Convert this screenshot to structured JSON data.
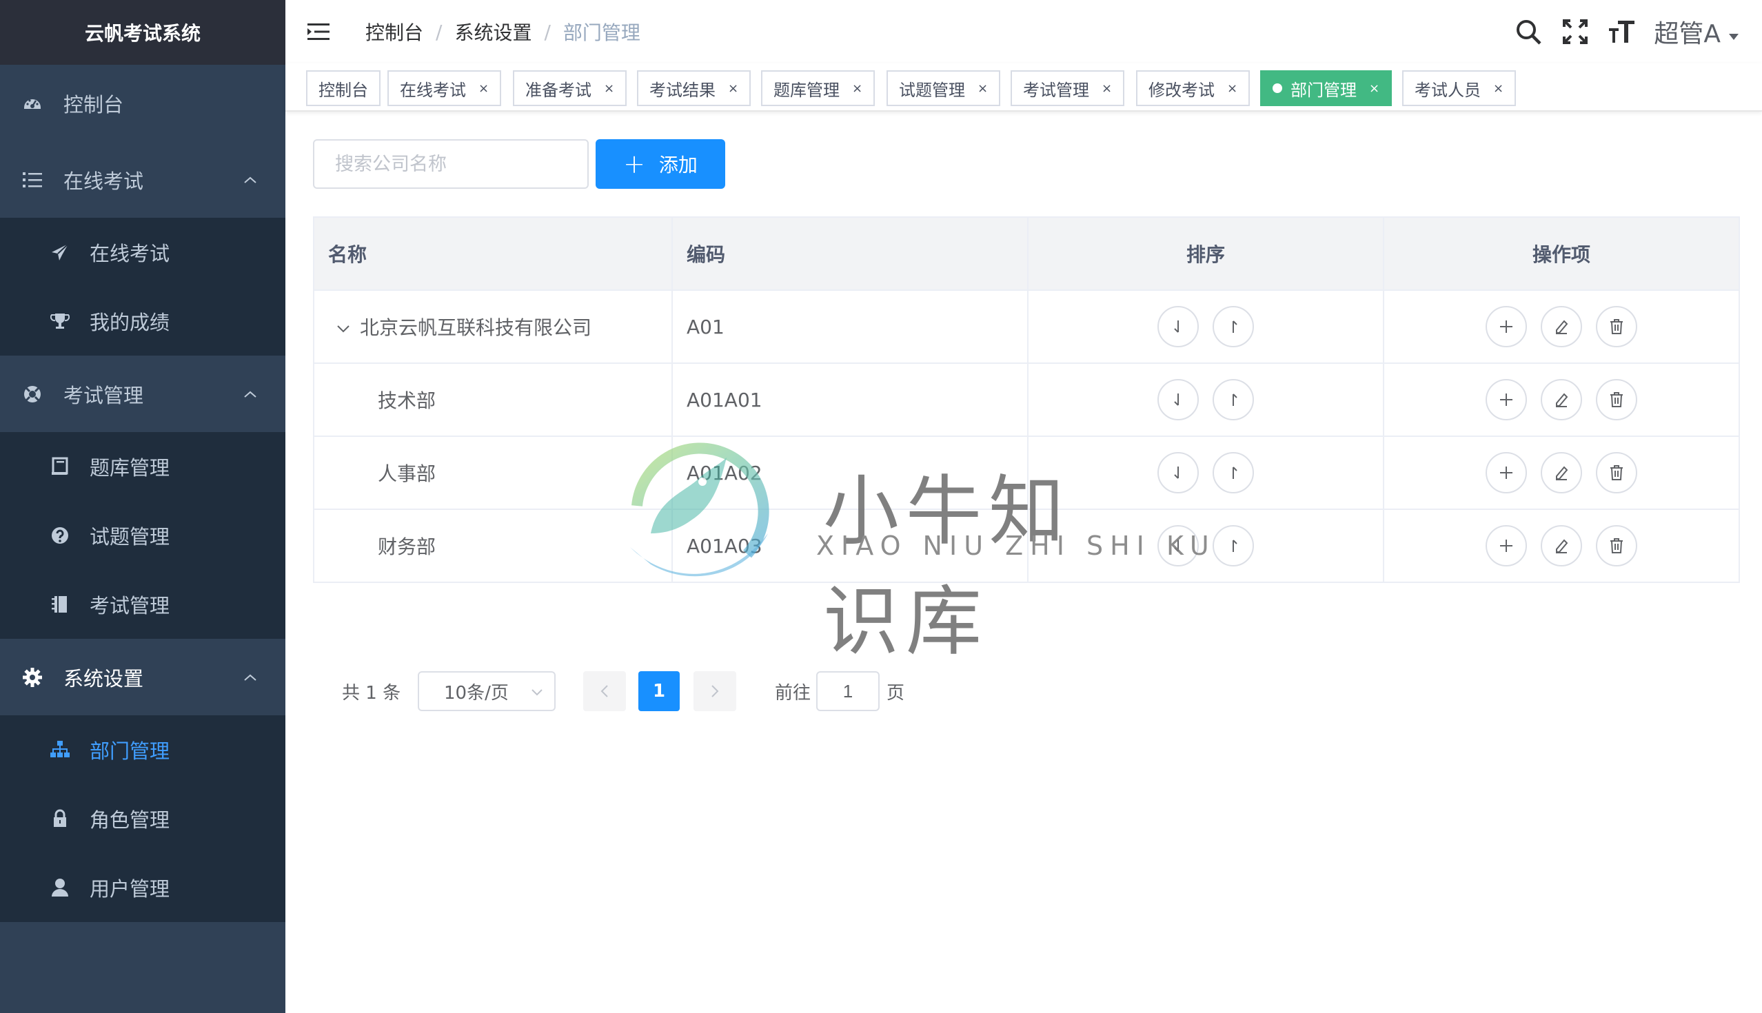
{
  "app": {
    "title": "云帆考试系统"
  },
  "sidebar": {
    "items": [
      {
        "label": "控制台",
        "icon": "dashboard-icon"
      },
      {
        "label": "在线考试",
        "icon": "list-icon",
        "children": [
          {
            "label": "在线考试",
            "icon": "paper-plane-icon"
          },
          {
            "label": "我的成绩",
            "icon": "trophy-icon"
          }
        ]
      },
      {
        "label": "考试管理",
        "icon": "lifebuoy-icon",
        "children": [
          {
            "label": "题库管理",
            "icon": "book-icon"
          },
          {
            "label": "试题管理",
            "icon": "question-icon"
          },
          {
            "label": "考试管理",
            "icon": "notebook-icon"
          }
        ]
      },
      {
        "label": "系统设置",
        "icon": "gear-icon",
        "children": [
          {
            "label": "部门管理",
            "icon": "sitemap-icon",
            "active": true
          },
          {
            "label": "角色管理",
            "icon": "lock-icon"
          },
          {
            "label": "用户管理",
            "icon": "user-icon"
          }
        ]
      }
    ]
  },
  "navbar": {
    "breadcrumb": [
      "控制台",
      "系统设置",
      "部门管理"
    ],
    "user_name": "超管A"
  },
  "tags": [
    {
      "label": "控制台",
      "closable": false
    },
    {
      "label": "在线考试",
      "closable": true
    },
    {
      "label": "准备考试",
      "closable": true
    },
    {
      "label": "考试结果",
      "closable": true
    },
    {
      "label": "题库管理",
      "closable": true
    },
    {
      "label": "试题管理",
      "closable": true
    },
    {
      "label": "考试管理",
      "closable": true
    },
    {
      "label": "修改考试",
      "closable": true
    },
    {
      "label": "部门管理",
      "closable": true,
      "active": true
    },
    {
      "label": "考试人员",
      "closable": true
    }
  ],
  "toolbar": {
    "search_placeholder": "搜索公司名称",
    "add_label": "添加"
  },
  "table": {
    "columns": [
      "名称",
      "编码",
      "排序",
      "操作项"
    ],
    "rows": [
      {
        "name": "北京云帆互联科技有限公司",
        "code": "A01",
        "level": 0,
        "expanded": true
      },
      {
        "name": "技术部",
        "code": "A01A01",
        "level": 1
      },
      {
        "name": "人事部",
        "code": "A01A02",
        "level": 1
      },
      {
        "name": "财务部",
        "code": "A01A03",
        "level": 1
      }
    ]
  },
  "pagination": {
    "total_text": "共 1 条",
    "page_size": "10条/页",
    "current_page": "1",
    "goto_label": "前往",
    "goto_value": "1",
    "page_unit": "页"
  },
  "watermark": {
    "title": "小牛知识库",
    "subtitle": "XIAO NIU ZHI SHI KU"
  },
  "colors": {
    "sidebar_bg": "#304156",
    "submenu_bg": "#1f2d3d",
    "brand_bg": "#2b2f3a",
    "primary": "#1890ff",
    "active_tag": "#42b983",
    "active_menu_text": "#409eff"
  }
}
